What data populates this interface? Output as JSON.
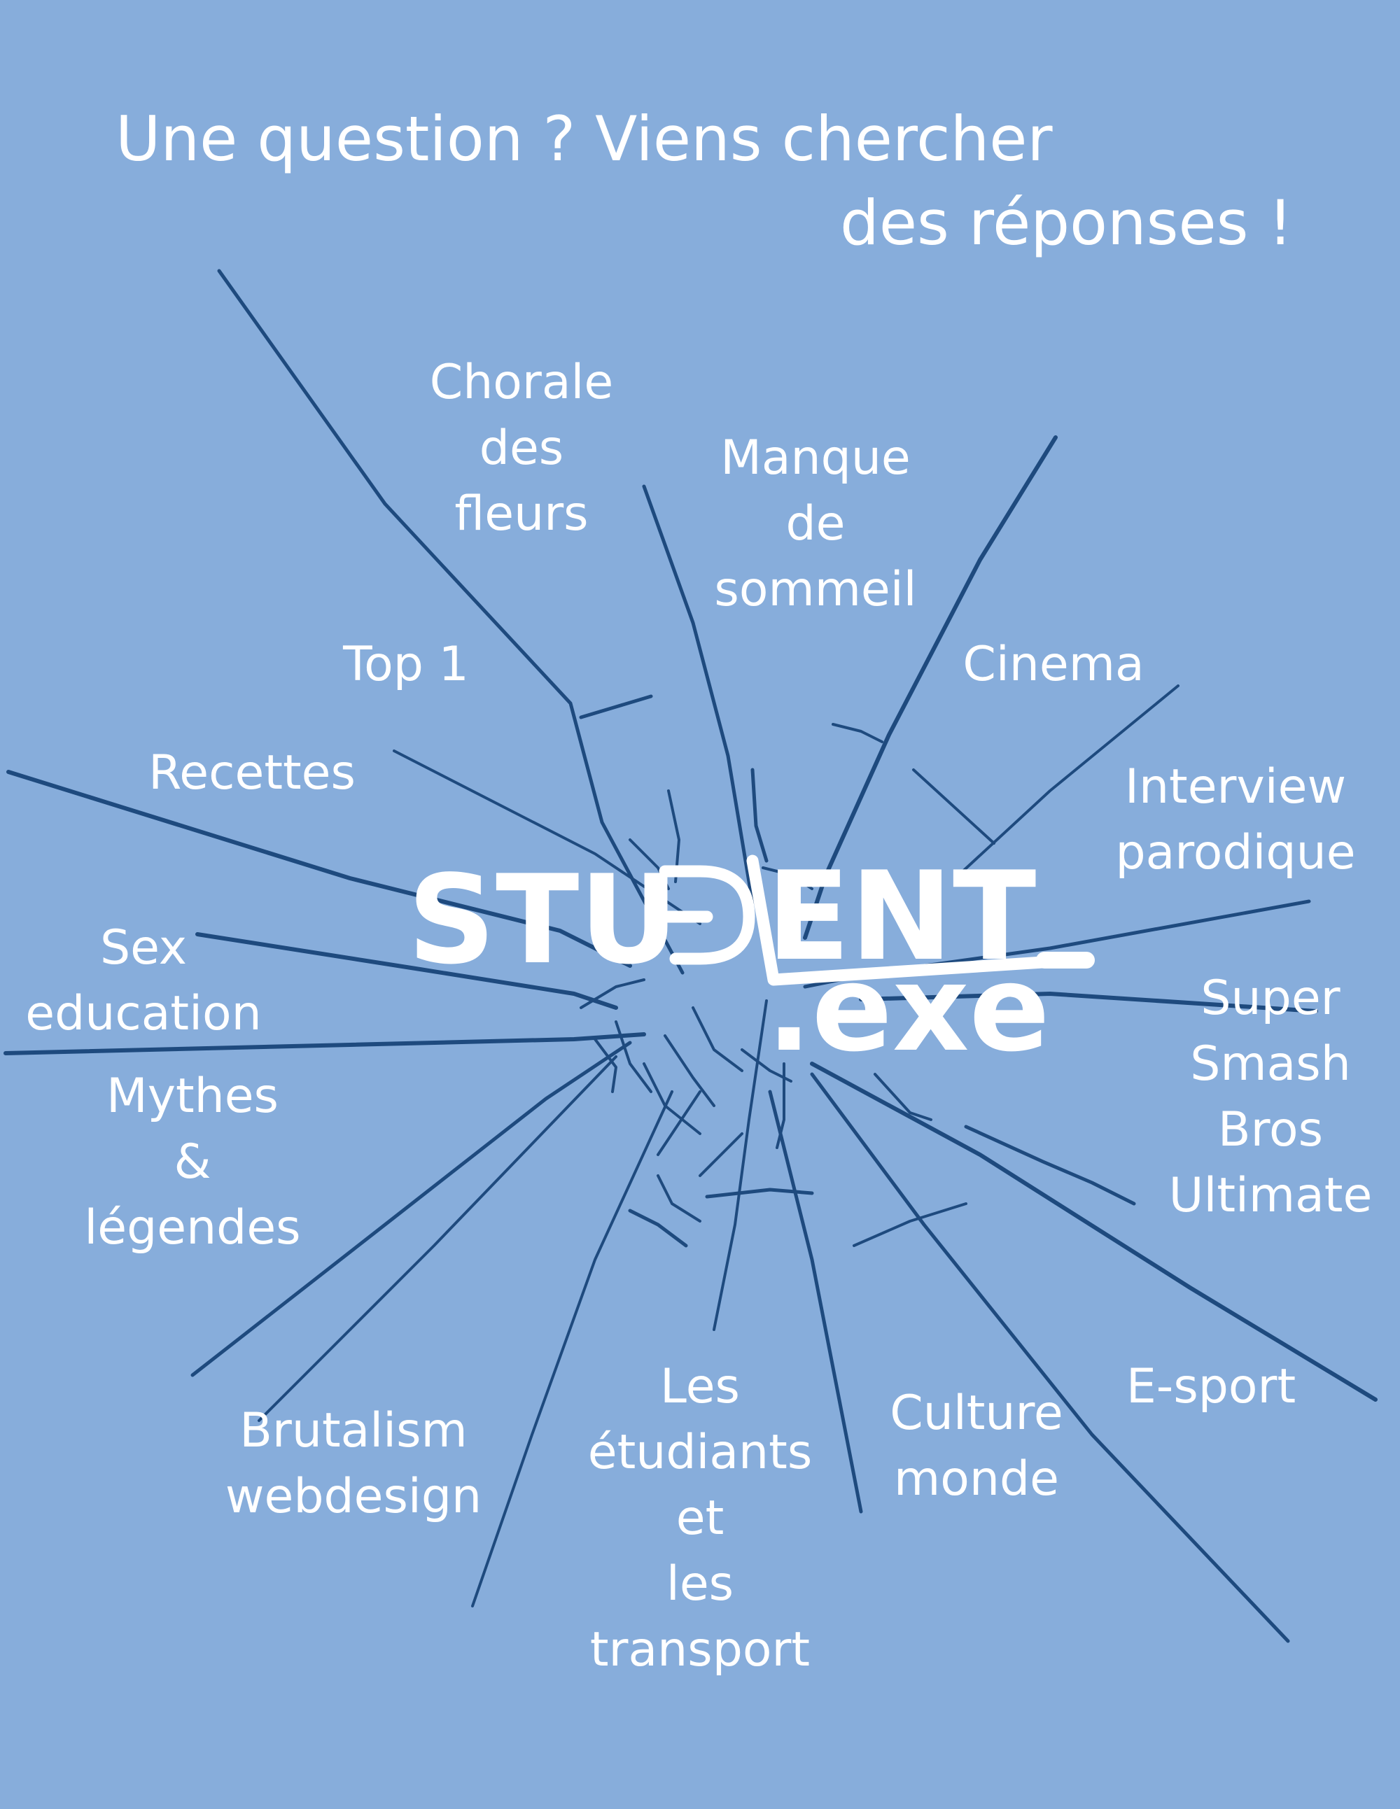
{
  "headline": {
    "line1": "Une question ? Viens chercher",
    "line2": "des réponses !"
  },
  "logo": {
    "text_student_left": "STU",
    "text_student_right": "ENT",
    "text_exe": ".exe"
  },
  "topics": {
    "chorale": [
      "Chorale",
      "des",
      "fleurs"
    ],
    "manque_sommeil": [
      "Manque",
      "de",
      "sommeil"
    ],
    "top1": [
      "Top 1"
    ],
    "cinema": [
      "Cinema"
    ],
    "recettes": [
      "Recettes"
    ],
    "interview": [
      "Interview",
      "parodique"
    ],
    "sex_education": [
      "Sex",
      "education"
    ],
    "smash": [
      "Super",
      "Smash",
      "Bros",
      "Ultimate"
    ],
    "mythes": [
      "Mythes",
      "&",
      "légendes"
    ],
    "esport": [
      "E-sport"
    ],
    "brutalism": [
      "Brutalism",
      "webdesign"
    ],
    "etudiants_transport": [
      "Les",
      "étudiants",
      "et",
      "les",
      "transport"
    ],
    "culture_monde": [
      "Culture",
      "monde"
    ]
  },
  "colors": {
    "background": "#87ADDB",
    "crack": "#1E4A7E",
    "text": "#FFFFFF"
  }
}
